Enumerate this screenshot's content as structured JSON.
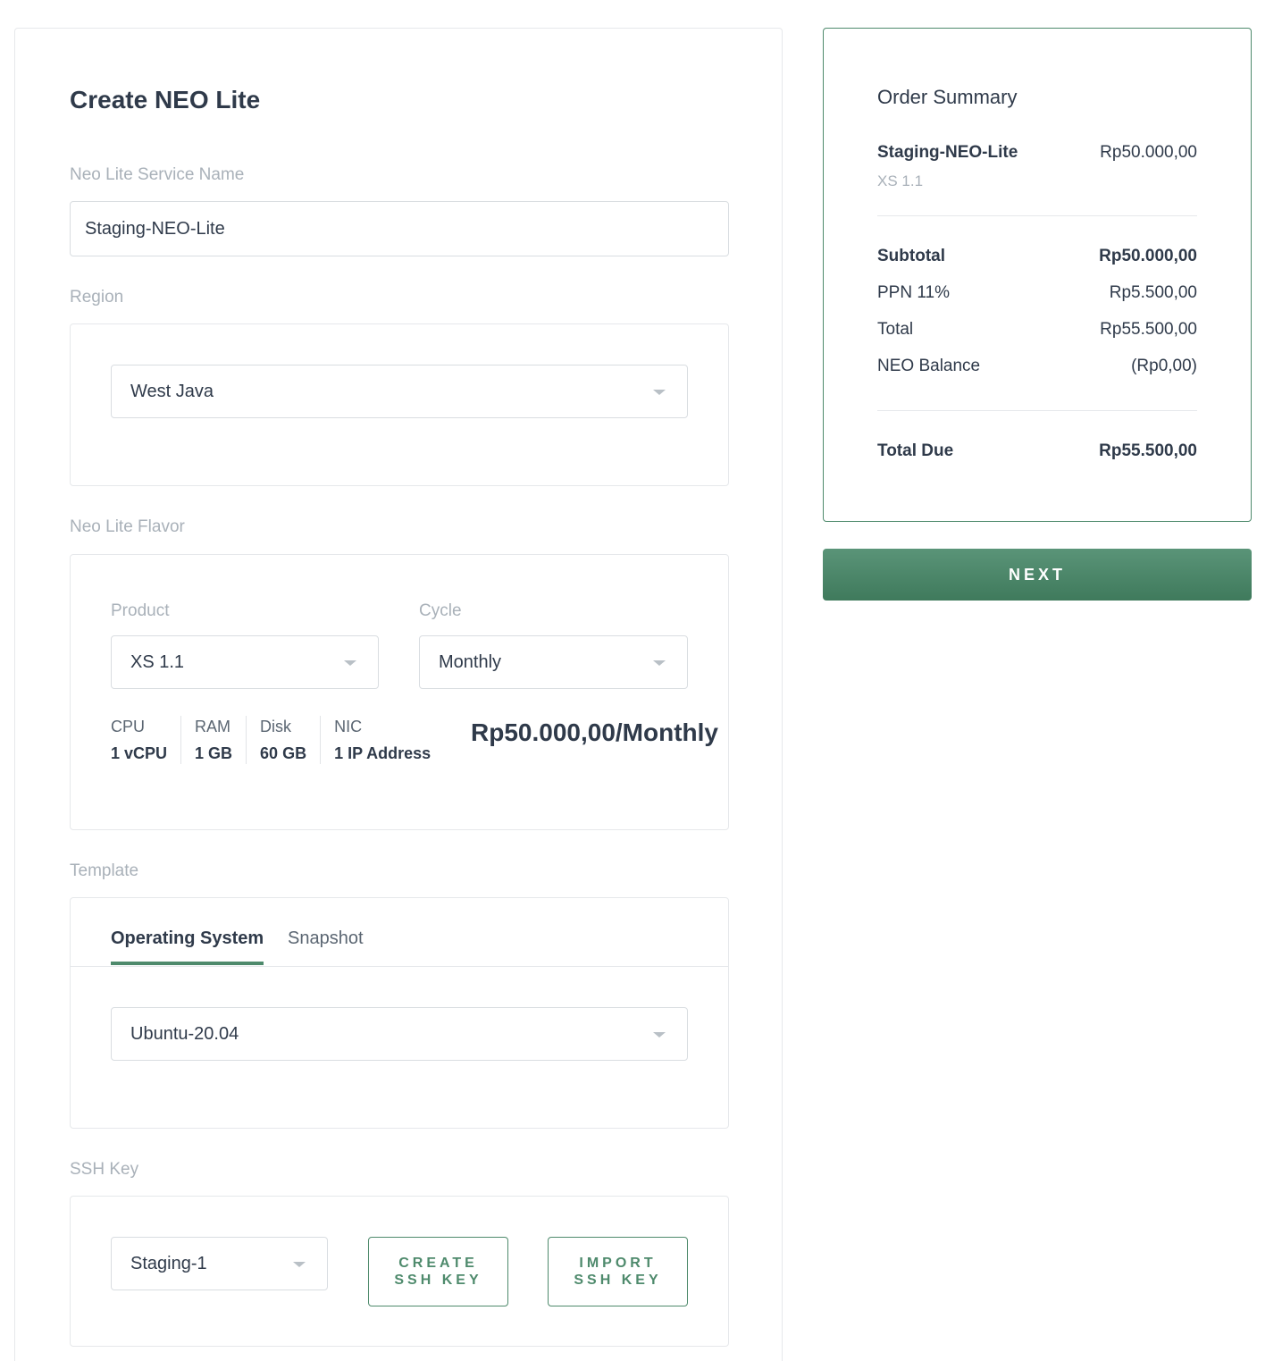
{
  "form": {
    "title": "Create NEO Lite",
    "service_name_label": "Neo Lite Service Name",
    "service_name_value": "Staging-NEO-Lite",
    "region_label": "Region",
    "region_value": "West Java",
    "flavor_label": "Neo Lite Flavor",
    "product_label": "Product",
    "product_value": "XS 1.1",
    "cycle_label": "Cycle",
    "cycle_value": "Monthly",
    "specs": [
      {
        "label": "CPU",
        "value": "1 vCPU"
      },
      {
        "label": "RAM",
        "value": "1 GB"
      },
      {
        "label": "Disk",
        "value": "60 GB"
      },
      {
        "label": "NIC",
        "value": "1 IP Address"
      }
    ],
    "price": "Rp50.000,00/Monthly",
    "template_label": "Template",
    "tabs": [
      {
        "label": "Operating System",
        "active": true
      },
      {
        "label": "Snapshot",
        "active": false
      }
    ],
    "os_value": "Ubuntu-20.04",
    "ssh_label": "SSH Key",
    "ssh_value": "Staging-1",
    "create_ssh": {
      "line1": "CREATE",
      "line2": "SSH KEY"
    },
    "import_ssh": {
      "line1": "IMPORT",
      "line2": "SSH KEY"
    }
  },
  "summary": {
    "title": "Order Summary",
    "item_name": "Staging-NEO-Lite",
    "item_price": "Rp50.000,00",
    "item_flavor": "XS 1.1",
    "rows": [
      {
        "label": "Subtotal",
        "value": "Rp50.000,00"
      },
      {
        "label": "PPN 11%",
        "value": "Rp5.500,00"
      },
      {
        "label": "Total",
        "value": "Rp55.500,00"
      },
      {
        "label": "NEO Balance",
        "value": "(Rp0,00)"
      }
    ],
    "total_due_label": "Total Due",
    "total_due_value": "Rp55.500,00"
  },
  "next_label": "NEXT",
  "colors": {
    "accent": "#4e8a6c",
    "text": "#2f3a4a",
    "muted": "#a9b1b9"
  }
}
